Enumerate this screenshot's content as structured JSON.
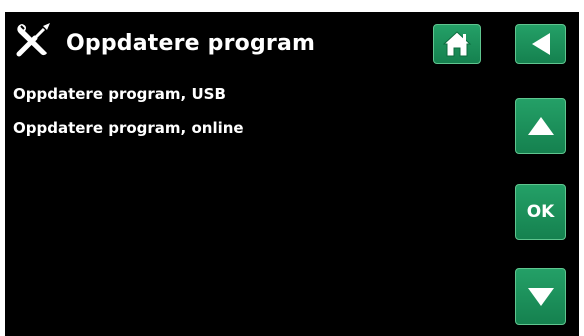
{
  "header": {
    "title": "Oppdatere program",
    "icon": "tools-icon"
  },
  "menu": {
    "items": [
      {
        "label": "Oppdatere program, USB"
      },
      {
        "label": "Oppdatere program, online"
      }
    ]
  },
  "nav": {
    "home_icon": "home-icon",
    "back_icon": "back-arrow-icon",
    "up_icon": "up-arrow-icon",
    "ok_label": "OK",
    "down_icon": "down-arrow-icon"
  },
  "colors": {
    "background": "#000000",
    "text": "#ffffff",
    "button": "#1a8c57",
    "button_border": "#5fc58f"
  }
}
